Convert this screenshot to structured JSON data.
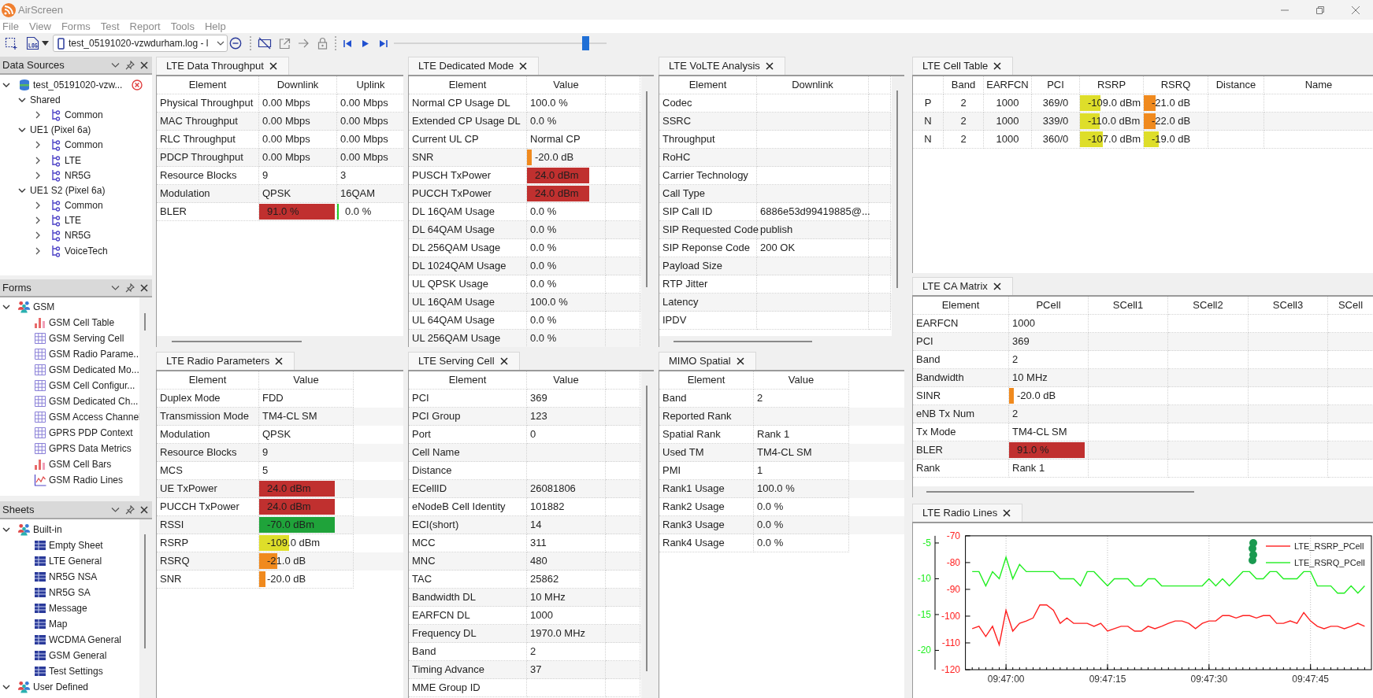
{
  "window": {
    "title": "AirScreen"
  },
  "menu": [
    "File",
    "View",
    "Forms",
    "Test",
    "Report",
    "Tools",
    "Help"
  ],
  "toolbar": {
    "file_select": {
      "value": "test_05191020-vzwdurham.log - l"
    },
    "playback": {
      "level": 0.9
    }
  },
  "sidebar": [
    {
      "title": "Data Sources",
      "tree": [
        {
          "label": "test_05191020-vzw...",
          "kind": "source",
          "expanded": true,
          "children": [
            {
              "label": "Shared",
              "kind": "group",
              "expanded": true,
              "children": [
                {
                  "label": "Common",
                  "kind": "node",
                  "expanded": false
                }
              ]
            },
            {
              "label": "UE1 (Pixel 6a)",
              "kind": "group",
              "expanded": true,
              "children": [
                {
                  "label": "Common",
                  "kind": "node",
                  "expanded": false
                },
                {
                  "label": "LTE",
                  "kind": "node",
                  "expanded": false
                },
                {
                  "label": "NR5G",
                  "kind": "node",
                  "expanded": false
                }
              ]
            },
            {
              "label": "UE1 S2 (Pixel 6a)",
              "kind": "group",
              "expanded": true,
              "children": [
                {
                  "label": "Common",
                  "kind": "node",
                  "expanded": false
                },
                {
                  "label": "LTE",
                  "kind": "node",
                  "expanded": false
                },
                {
                  "label": "NR5G",
                  "kind": "node",
                  "expanded": false
                },
                {
                  "label": "VoiceTech",
                  "kind": "node",
                  "expanded": false
                }
              ]
            }
          ]
        }
      ]
    },
    {
      "title": "Forms",
      "tree": [
        {
          "label": "GSM",
          "kind": "category",
          "expanded": true,
          "children": [
            {
              "label": "GSM Cell Table",
              "kind": "chart"
            },
            {
              "label": "GSM Serving Cell",
              "kind": "form"
            },
            {
              "label": "GSM Radio Parame...",
              "kind": "form"
            },
            {
              "label": "GSM Dedicated Mo...",
              "kind": "form"
            },
            {
              "label": "GSM Cell Configur...",
              "kind": "form"
            },
            {
              "label": "GSM Dedicated Ch...",
              "kind": "form"
            },
            {
              "label": "GSM Access Channel",
              "kind": "form"
            },
            {
              "label": "GPRS PDP Context",
              "kind": "form"
            },
            {
              "label": "GPRS Data Metrics",
              "kind": "form"
            },
            {
              "label": "GSM Cell Bars",
              "kind": "chart"
            },
            {
              "label": "GSM Radio Lines",
              "kind": "graph"
            }
          ]
        }
      ]
    },
    {
      "title": "Sheets",
      "tree": [
        {
          "label": "Built-in",
          "kind": "category",
          "expanded": true,
          "children": [
            {
              "label": "Empty Sheet",
              "kind": "sheet"
            },
            {
              "label": "LTE General",
              "kind": "sheet"
            },
            {
              "label": "NR5G NSA",
              "kind": "sheet"
            },
            {
              "label": "NR5G SA",
              "kind": "sheet"
            },
            {
              "label": "Message",
              "kind": "sheet"
            },
            {
              "label": "Map",
              "kind": "sheet"
            },
            {
              "label": "WCDMA General",
              "kind": "sheet"
            },
            {
              "label": "GSM General",
              "kind": "sheet"
            },
            {
              "label": "Test Settings",
              "kind": "sheet"
            }
          ]
        },
        {
          "label": "User Defined",
          "kind": "category",
          "expanded": true
        }
      ]
    }
  ],
  "panels": [
    {
      "title": "LTE Data Throughput",
      "kind": "table",
      "columns": [
        "Element",
        "Downlink",
        "Uplink"
      ],
      "rows": [
        [
          "Physical Throughput",
          "0.00 Mbps",
          "0.00 Mbps"
        ],
        [
          "MAC Throughput",
          "0.00 Mbps",
          "0.00 Mbps"
        ],
        [
          "RLC Throughput",
          "0.00 Mbps",
          "0.00 Mbps"
        ],
        [
          "PDCP Throughput",
          "0.00 Mbps",
          "0.00 Mbps"
        ],
        [
          "Resource Blocks",
          "9",
          "3"
        ],
        [
          "Modulation",
          "QPSK",
          "16QAM"
        ],
        [
          "BLER",
          {
            "text": "91.0 %",
            "level": 0.98,
            "color": "#c0302f"
          },
          {
            "text": "0.0 %",
            "level": 0.02,
            "color": "#22cc22"
          }
        ]
      ]
    },
    {
      "title": "LTE Dedicated Mode",
      "kind": "table",
      "columns": [
        "Element",
        "Value"
      ],
      "rows": [
        [
          "Normal CP Usage DL",
          "100.0 %"
        ],
        [
          "Extended CP Usage DL",
          "0.0 %"
        ],
        [
          "Current UL CP",
          "Normal CP"
        ],
        [
          "SNR",
          {
            "text": "-20.0 dB",
            "level": 0.06,
            "color": "#f08a1e"
          }
        ],
        [
          "PUSCH TxPower",
          {
            "text": "24.0 dBm",
            "level": 0.8,
            "color": "#c0302f"
          }
        ],
        [
          "PUCCH TxPower",
          {
            "text": "24.0 dBm",
            "level": 0.8,
            "color": "#c0302f"
          }
        ],
        [
          "DL 16QAM Usage",
          "0.0 %"
        ],
        [
          "DL 64QAM Usage",
          "0.0 %"
        ],
        [
          "DL 256QAM Usage",
          "0.0 %"
        ],
        [
          "DL 1024QAM Usage",
          "0.0 %"
        ],
        [
          "UL QPSK Usage",
          "0.0 %"
        ],
        [
          "UL 16QAM Usage",
          "100.0 %"
        ],
        [
          "UL 64QAM Usage",
          "0.0 %"
        ],
        [
          "UL 256QAM Usage",
          "0.0 %"
        ]
      ]
    },
    {
      "title": "LTE VoLTE Analysis",
      "kind": "table",
      "columns": [
        "Element",
        "Downlink"
      ],
      "rows": [
        [
          "Codec"
        ],
        [
          "SSRC"
        ],
        [
          "Throughput"
        ],
        [
          "RoHC"
        ],
        [
          "Carrier Technology"
        ],
        [
          "Call Type"
        ],
        [
          "SIP Call ID",
          "6886e53d99419885@..."
        ],
        [
          "SIP Requested Code",
          "publish"
        ],
        [
          "SIP Reponse Code",
          "200 OK"
        ],
        [
          "Payload Size"
        ],
        [
          "RTP Jitter"
        ],
        [
          "Latency"
        ],
        [
          "IPDV"
        ]
      ]
    },
    {
      "title": "LTE Cell Table",
      "kind": "table",
      "columns": [
        "",
        "Band",
        "EARFCN",
        "PCI",
        "RSRP",
        "RSRQ",
        "Distance",
        "Name"
      ],
      "rows": [
        [
          "P",
          "2",
          "1000",
          "369/0",
          {
            "text": "-109.0 dBm",
            "level": 0.32,
            "color": "#dede2a"
          },
          {
            "text": "-21.0 dB",
            "level": 0.19,
            "color": "#f08a1e"
          }
        ],
        [
          "N",
          "2",
          "1000",
          "339/0",
          {
            "text": "-110.0 dBm",
            "level": 0.31,
            "color": "#dede2a"
          },
          {
            "text": "-22.0 dB",
            "level": 0.19,
            "color": "#f08a1e"
          }
        ],
        [
          "N",
          "2",
          "1000",
          "360/0",
          {
            "text": "-107.0 dBm",
            "level": 0.36,
            "color": "#dede2a"
          },
          {
            "text": "-19.0 dB",
            "level": 0.24,
            "color": "#dede2a"
          }
        ]
      ]
    },
    {
      "title": "LTE Radio Parameters",
      "kind": "table",
      "columns": [
        "Element",
        "Value"
      ],
      "rows": [
        [
          "Duplex Mode",
          "FDD"
        ],
        [
          "Transmission Mode",
          "TM4-CL SM"
        ],
        [
          "Modulation",
          "QPSK"
        ],
        [
          "Resource Blocks",
          "9"
        ],
        [
          "MCS",
          "5"
        ],
        [
          "UE TxPower",
          {
            "text": "24.0 dBm",
            "level": 0.81,
            "color": "#c0302f"
          }
        ],
        [
          "PUCCH TxPower",
          {
            "text": "24.0 dBm",
            "level": 0.81,
            "color": "#c0302f"
          }
        ],
        [
          "RSSI",
          {
            "text": "-70.0 dBm",
            "level": 0.81,
            "color": "#1fa33a"
          }
        ],
        [
          "RSRP",
          {
            "text": "-109.0 dBm",
            "level": 0.32,
            "color": "#dede2a"
          }
        ],
        [
          "RSRQ",
          {
            "text": "-21.0 dB",
            "level": 0.19,
            "color": "#f08a1e"
          }
        ],
        [
          "SNR",
          {
            "text": "-20.0 dB",
            "level": 0.07,
            "color": "#f08a1e"
          }
        ]
      ]
    },
    {
      "title": "LTE Serving Cell",
      "kind": "table",
      "columns": [
        "Element",
        "Value"
      ],
      "rows": [
        [
          "PCI",
          "369"
        ],
        [
          "PCI Group",
          "123"
        ],
        [
          "Port",
          "0"
        ],
        [
          "Cell Name"
        ],
        [
          "Distance"
        ],
        [
          "ECellID",
          "26081806"
        ],
        [
          "eNodeB Cell Identity",
          "101882"
        ],
        [
          "ECI(short)",
          "14"
        ],
        [
          "MCC",
          "311"
        ],
        [
          "MNC",
          "480"
        ],
        [
          "TAC",
          "25862"
        ],
        [
          "Bandwidth DL",
          "10 MHz"
        ],
        [
          "EARFCN DL",
          "1000"
        ],
        [
          "Frequency DL",
          "1970.0 MHz"
        ],
        [
          "Band",
          "2"
        ],
        [
          "Timing Advance",
          "37"
        ],
        [
          "MME Group ID"
        ]
      ]
    },
    {
      "title": "MIMO Spatial",
      "kind": "table",
      "columns": [
        "Element",
        "Value"
      ],
      "rows": [
        [
          "Band",
          "2"
        ],
        [
          "Reported Rank"
        ],
        [
          "Spatial Rank",
          "Rank 1"
        ],
        [
          "Used TM",
          "TM4-CL SM"
        ],
        [
          "PMI",
          "1"
        ],
        [
          "Rank1 Usage",
          "100.0 %"
        ],
        [
          "Rank2 Usage",
          "0.0 %"
        ],
        [
          "Rank3 Usage",
          "0.0 %"
        ],
        [
          "Rank4 Usage",
          "0.0 %"
        ]
      ]
    },
    {
      "title": "LTE CA Matrix",
      "kind": "table",
      "columns": [
        "Element",
        "PCell",
        "SCell1",
        "SCell2",
        "SCell3",
        "SCell"
      ],
      "rows": [
        [
          "EARFCN",
          "1000"
        ],
        [
          "PCI",
          "369"
        ],
        [
          "Band",
          "2"
        ],
        [
          "Bandwidth",
          "10 MHz"
        ],
        [
          "SINR",
          {
            "text": "-20.0 dB",
            "level": 0.06,
            "color": "#f08a1e"
          }
        ],
        [
          "eNB Tx Num",
          "2"
        ],
        [
          "Tx Mode",
          "TM4-CL SM"
        ],
        [
          "BLER",
          {
            "text": "91.0 %",
            "level": 0.96,
            "color": "#c0302f"
          }
        ],
        [
          "Rank",
          "Rank 1"
        ]
      ]
    },
    {
      "title": "LTE Radio Lines",
      "kind": "chart",
      "chart_data": {
        "type": "line",
        "categories": [
          null,
          null,
          null,
          null,
          null,
          "09:47:00",
          null,
          null,
          null,
          null,
          null,
          null,
          null,
          null,
          null,
          null,
          null,
          null,
          null,
          null,
          "09:47:15",
          null,
          null,
          null,
          null,
          null,
          null,
          null,
          null,
          null,
          null,
          null,
          null,
          null,
          null,
          "09:47:30",
          null,
          null,
          null,
          null,
          null,
          null,
          null,
          null,
          null,
          null,
          null,
          null,
          null,
          null,
          "09:47:45",
          null,
          null,
          null,
          null,
          null,
          null,
          null,
          null
        ],
        "series": [
          {
            "name": "LTE_RSRP_PCell",
            "color": "#ff2020",
            "axis": "y",
            "values": [
              -104.7,
              -103.8,
              -107.6,
              -103.8,
              -110.7,
              -97.8,
              -105.6,
              -102.7,
              -101.8,
              -100.7,
              -95.8,
              -95.8,
              -97.8,
              -102.7,
              -100.7,
              -102.7,
              -102.7,
              -102.7,
              -103.8,
              -102.7,
              -105.6,
              -104.7,
              -103.8,
              -103.8,
              -105.6,
              -105.6,
              -103.8,
              -104.7,
              -103.8,
              -102.7,
              -101.8,
              -101.8,
              -102.7,
              -104.7,
              -102.7,
              -101.8,
              -101.8,
              -99.8,
              -99.8,
              -100.7,
              -99.8,
              -99.8,
              -100.7,
              -99.8,
              -99.8,
              -102.7,
              -102.7,
              -101.8,
              -102.7,
              -98.7,
              -101.8,
              -103.8,
              -104.7,
              -103.8,
              -103.8,
              -104.7,
              -103.8,
              -102.7,
              -103.8
            ]
          },
          {
            "name": "LTE_RSRQ_PCell",
            "color": "#22ee22",
            "axis": "y2",
            "values": [
              -9,
              -9,
              -11,
              -9,
              -10,
              -7,
              -10,
              -8,
              -9,
              -9,
              -9,
              -9,
              -9,
              -10,
              -10,
              -10,
              -11,
              -9,
              -9,
              -10,
              -11,
              -10,
              -10,
              -10,
              -11,
              -11,
              -10,
              -10,
              -11,
              -11,
              -11,
              -11,
              -11,
              -11,
              -11,
              -10,
              -11,
              -10,
              -11,
              -10,
              -9,
              -9,
              -10,
              -10,
              -9,
              -9,
              -10,
              -10,
              -10,
              -9,
              -9,
              -11,
              -11,
              -11,
              -12,
              -12,
              -11,
              -12,
              -11
            ]
          }
        ],
        "ylim": [
          -120,
          -70
        ],
        "yticks": [
          -70,
          -80,
          -90,
          -100,
          -110,
          -120
        ],
        "y2lim": [
          -22.7,
          -4
        ],
        "y2ticks": [
          -5,
          -10,
          -15,
          -20
        ],
        "grid": true,
        "legend": "upper right"
      }
    }
  ]
}
